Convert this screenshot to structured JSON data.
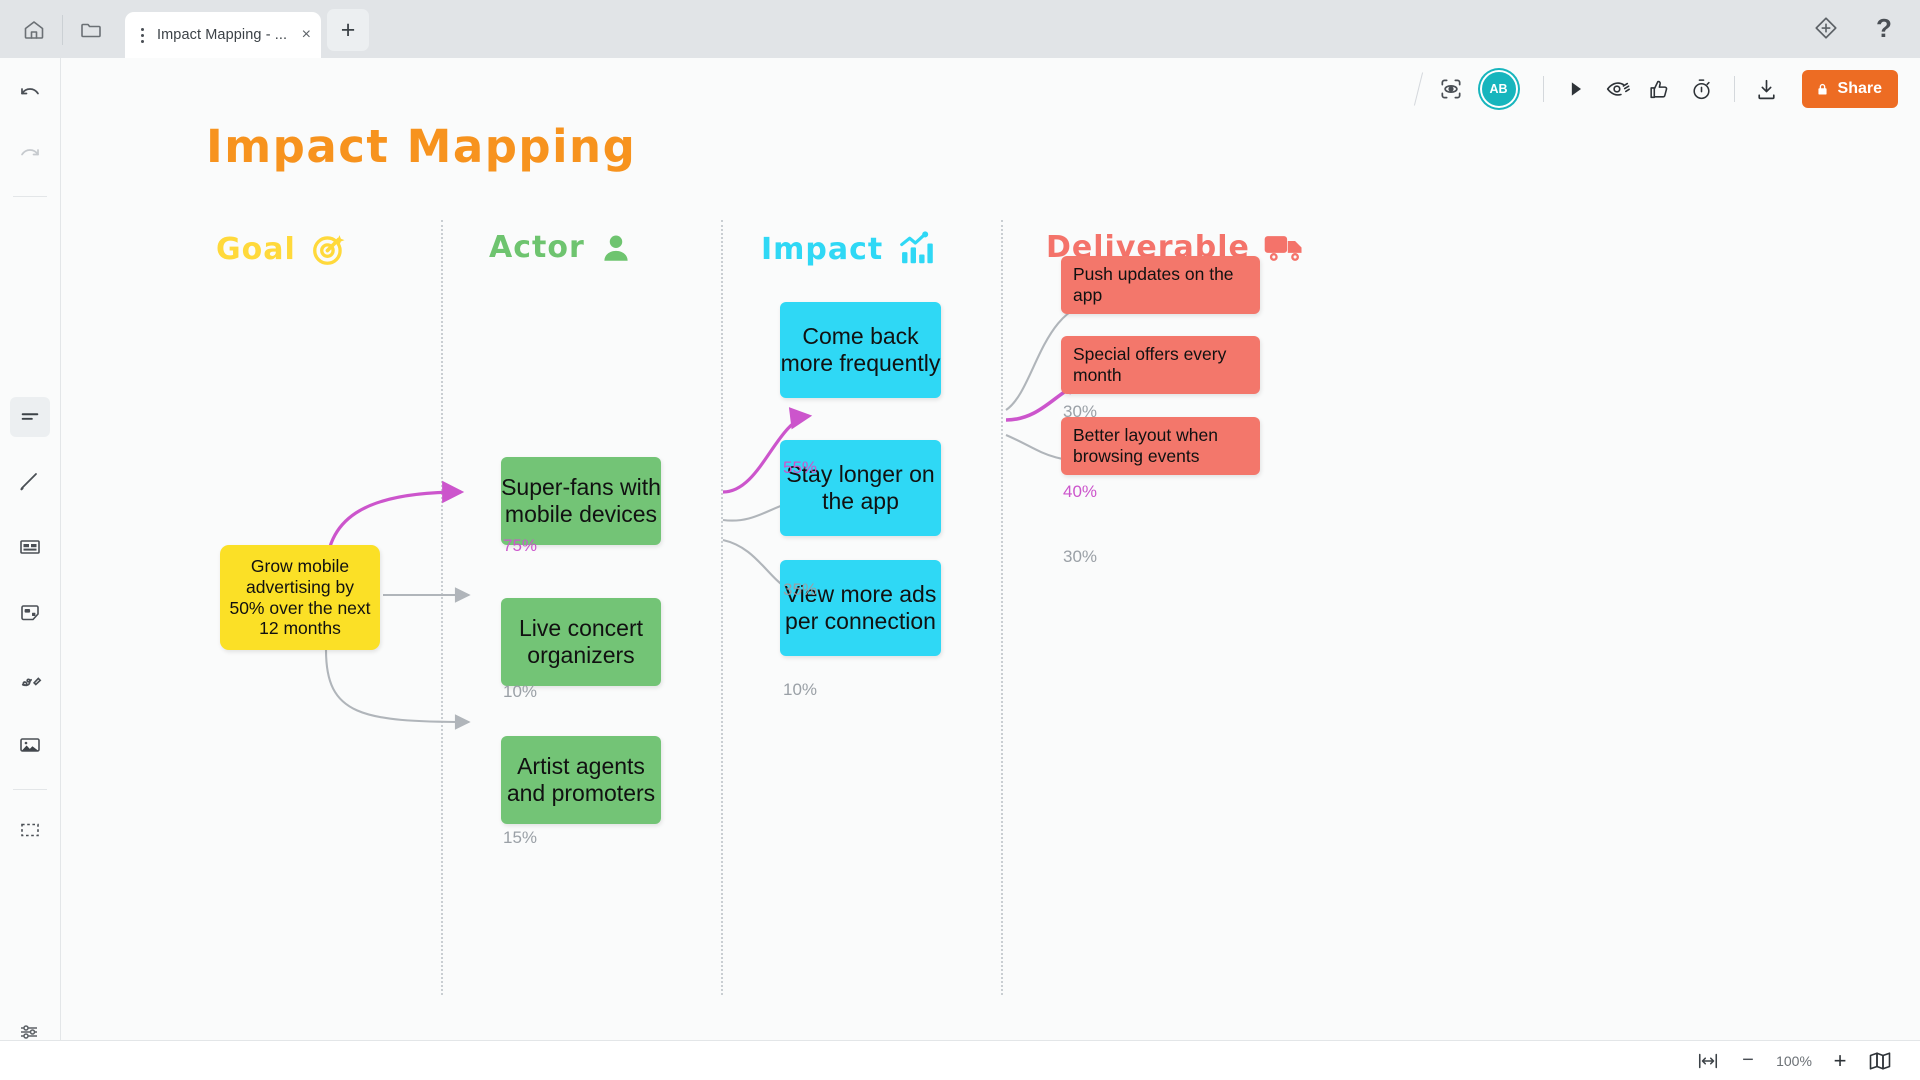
{
  "tabbar": {
    "home_icon": "home-icon",
    "folder_icon": "folder-icon",
    "tab_title": "Impact Mapping - ...",
    "close_label": "×",
    "newtab_label": "+",
    "diamond_icon": "diamond-icon",
    "help_label": "?"
  },
  "toolbar": {
    "present_icon": "presentation-capture-icon",
    "avatar_initials": "AB",
    "play_icon": "play-icon",
    "hide_icon": "eye-hidden-icon",
    "like_icon": "thumbs-up-icon",
    "timer_icon": "timer-icon",
    "download_icon": "download-icon",
    "share_label": "Share",
    "share_lock_icon": "lock-icon",
    "share_color": "#ed6c23"
  },
  "sidebar": {
    "items": [
      {
        "name": "undo-icon",
        "label": "Undo"
      },
      {
        "name": "redo-icon",
        "label": "Redo"
      },
      {
        "name": "text-icon",
        "label": "Text"
      },
      {
        "name": "line-icon",
        "label": "Line"
      },
      {
        "name": "card-icon",
        "label": "Card"
      },
      {
        "name": "shape-icon",
        "label": "Shape"
      },
      {
        "name": "pen-icon",
        "label": "Pen"
      },
      {
        "name": "image-icon",
        "label": "Image"
      },
      {
        "name": "frame-icon",
        "label": "Frame"
      },
      {
        "name": "settings-sliders-icon",
        "label": "Settings"
      }
    ]
  },
  "board": {
    "title": "Impact Mapping",
    "title_color": "#f7931e",
    "columns": [
      {
        "label": "Goal",
        "color": "#ffd93b",
        "icon": "target-icon"
      },
      {
        "label": "Actor",
        "color": "#6ec46f",
        "icon": "person-icon"
      },
      {
        "label": "Impact",
        "color": "#2fd8f5",
        "icon": "bar-chart-icon"
      },
      {
        "label": "Deliverable",
        "color": "#f4736a",
        "icon": "truck-icon"
      }
    ],
    "goal": {
      "text": "Grow mobile advertising by 50% over the next 12 months",
      "color": "#fbe026"
    },
    "actors": [
      {
        "text": "Super-fans with mobile devices",
        "weight": "75%",
        "highlight": true
      },
      {
        "text": "Live concert organizers",
        "weight": "10%",
        "highlight": false
      },
      {
        "text": "Artist agents and promoters",
        "weight": "15%",
        "highlight": false
      }
    ],
    "impacts": [
      {
        "text": "Come back more frequently",
        "weight": "55%",
        "highlight": true
      },
      {
        "text": "Stay longer on the app",
        "weight": "35%",
        "highlight": false
      },
      {
        "text": "View more ads per connection",
        "weight": "10%",
        "highlight": false
      }
    ],
    "deliverables": [
      {
        "text": "Push updates on the app",
        "weight": "30%",
        "highlight": false
      },
      {
        "text": "Special offers every month",
        "weight": "40%",
        "highlight": true
      },
      {
        "text": "Better layout when browsing events",
        "weight": "30%",
        "highlight": false
      }
    ],
    "colors": {
      "goal": "#fbe026",
      "actor": "#73c476",
      "impact": "#2fd8f5",
      "deliverable": "#f3776b",
      "edge": "#b0b5ba",
      "edge_highlight": "#cc55cc"
    }
  },
  "statusbar": {
    "fit_icon": "fit-width-icon",
    "zoom_out_label": "−",
    "zoom_level": "100%",
    "zoom_in_label": "+",
    "minimap_icon": "minimap-icon"
  }
}
